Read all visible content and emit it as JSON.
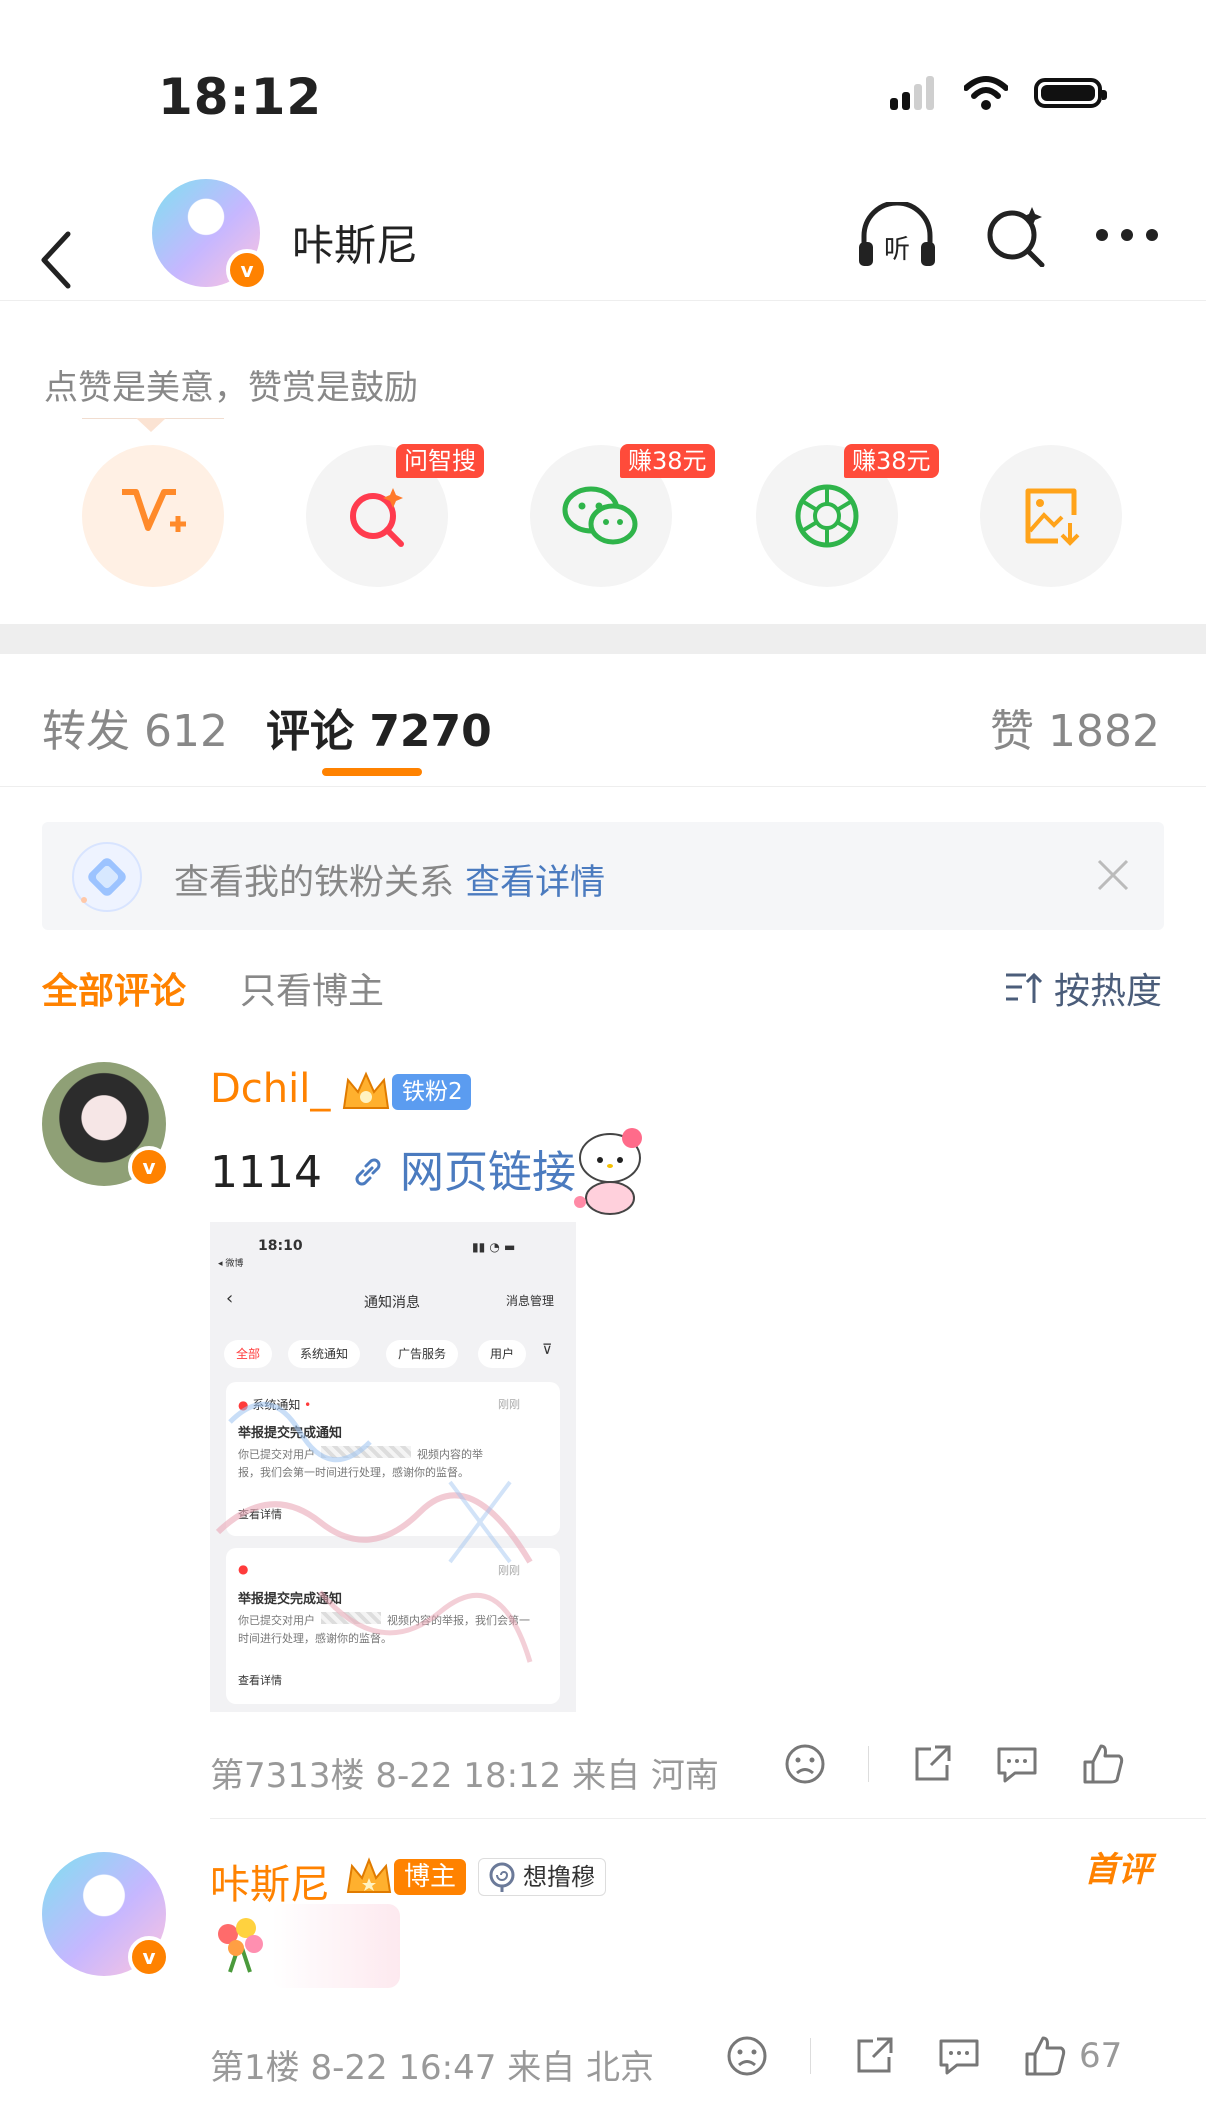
{
  "status": {
    "time": "18:12"
  },
  "nav": {
    "title": "咔斯尼",
    "listen_label": "听"
  },
  "hint": "点赞是美意，赞赏是鼓励",
  "actions": [
    {
      "icon": "vplus-icon",
      "tag": ""
    },
    {
      "icon": "ai-search-icon",
      "tag": "问智搜"
    },
    {
      "icon": "wechat-icon",
      "tag": "赚38元"
    },
    {
      "icon": "moments-icon",
      "tag": "赚38元"
    },
    {
      "icon": "save-image-icon",
      "tag": ""
    }
  ],
  "tabs": {
    "repost": "转发 612",
    "comments": "评论 7270",
    "likes": "赞 1882"
  },
  "fan_banner": {
    "text": "查看我的铁粉关系",
    "link": "查看详情"
  },
  "filters": {
    "all": "全部评论",
    "blogger": "只看博主",
    "sort": "按热度"
  },
  "comments": [
    {
      "name": "Dchil_",
      "badge": "铁粉2",
      "text": "1114",
      "link": "网页链接",
      "meta": "第7313楼 8-22 18:12 来自 河南",
      "likes": "",
      "screenshot": {
        "time": "18:10",
        "back_app": "◂ 微博",
        "title": "通知消息",
        "manage": "消息管理",
        "chips": [
          "全部",
          "系统通知",
          "广告服务",
          "用户"
        ],
        "card1": {
          "source": "系统通知",
          "time": "刚刚",
          "title": "举报提交完成通知",
          "body1": "你已提交对用户",
          "body1b": "视频内容的举",
          "body2": "报，我们会第一时间进行处理，感谢你的监督。",
          "more": "查看详情"
        },
        "card2": {
          "time": "刚刚",
          "title": "举报提交完成通知",
          "body1": "你已提交对用户",
          "body1b": "视频内容的举报，我们会第一",
          "body2": "时间进行处理，感谢你的监督。",
          "more": "查看详情"
        }
      }
    },
    {
      "name": "咔斯尼",
      "badge": "博主",
      "topic": "想撸穆",
      "first_label": "首评",
      "meta": "第1楼 8-22 16:47 来自 北京",
      "likes": "67"
    }
  ]
}
